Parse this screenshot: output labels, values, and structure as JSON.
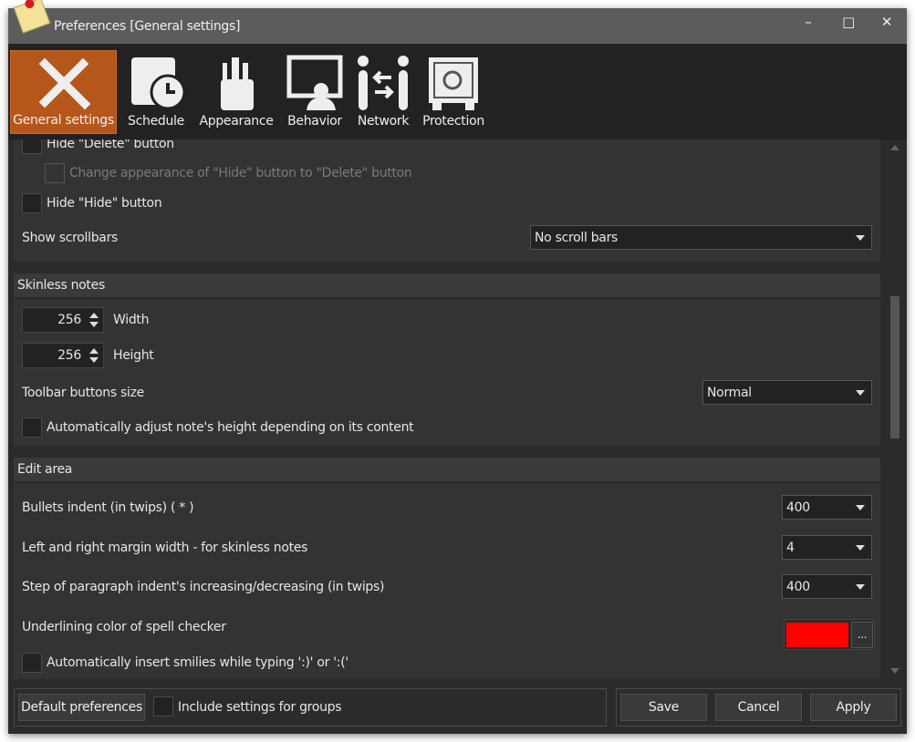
{
  "window": {
    "title": "Preferences [General settings]",
    "minimize": "–",
    "maximize": "□",
    "close": "✕"
  },
  "colors": {
    "accent": "#b5561a",
    "spell_color": "#ff0000"
  },
  "tabs": [
    {
      "label": "General settings",
      "icon": "pencil-ruler-icon",
      "active": true
    },
    {
      "label": "Schedule",
      "icon": "calendar-clock-icon"
    },
    {
      "label": "Appearance",
      "icon": "brush-cup-icon"
    },
    {
      "label": "Behavior",
      "icon": "monitor-person-icon"
    },
    {
      "label": "Network",
      "icon": "people-exchange-icon"
    },
    {
      "label": "Protection",
      "icon": "safe-icon"
    }
  ],
  "section1": {
    "hide_delete": "Hide \"Delete\" button",
    "change_appearance": "Change appearance of \"Hide\" button to \"Delete\" button",
    "hide_hide": "Hide \"Hide\" button",
    "show_scrollbars": "Show scrollbars",
    "show_scrollbars_value": "No scroll bars"
  },
  "skinless": {
    "header": "Skinless notes",
    "width_value": "256",
    "width_label": "Width",
    "height_value": "256",
    "height_label": "Height",
    "toolbar_size_label": "Toolbar buttons size",
    "toolbar_size_value": "Normal",
    "auto_adjust": "Automatically adjust note's height depending on its content"
  },
  "edit": {
    "header": "Edit area",
    "bullets_label": "Bullets indent (in twips) ( * )",
    "bullets_value": "400",
    "margin_label": "Left and right margin width - for skinless notes",
    "margin_value": "4",
    "step_label": "Step of paragraph indent's increasing/decreasing (in twips)",
    "step_value": "400",
    "underline_label": "Underlining color of spell checker",
    "color_button": "...",
    "smilies": "Automatically insert smilies while typing ':)' or ':('"
  },
  "footer": {
    "default": "Default preferences",
    "include_groups": "Include settings for groups",
    "save": "Save",
    "cancel": "Cancel",
    "apply": "Apply"
  }
}
